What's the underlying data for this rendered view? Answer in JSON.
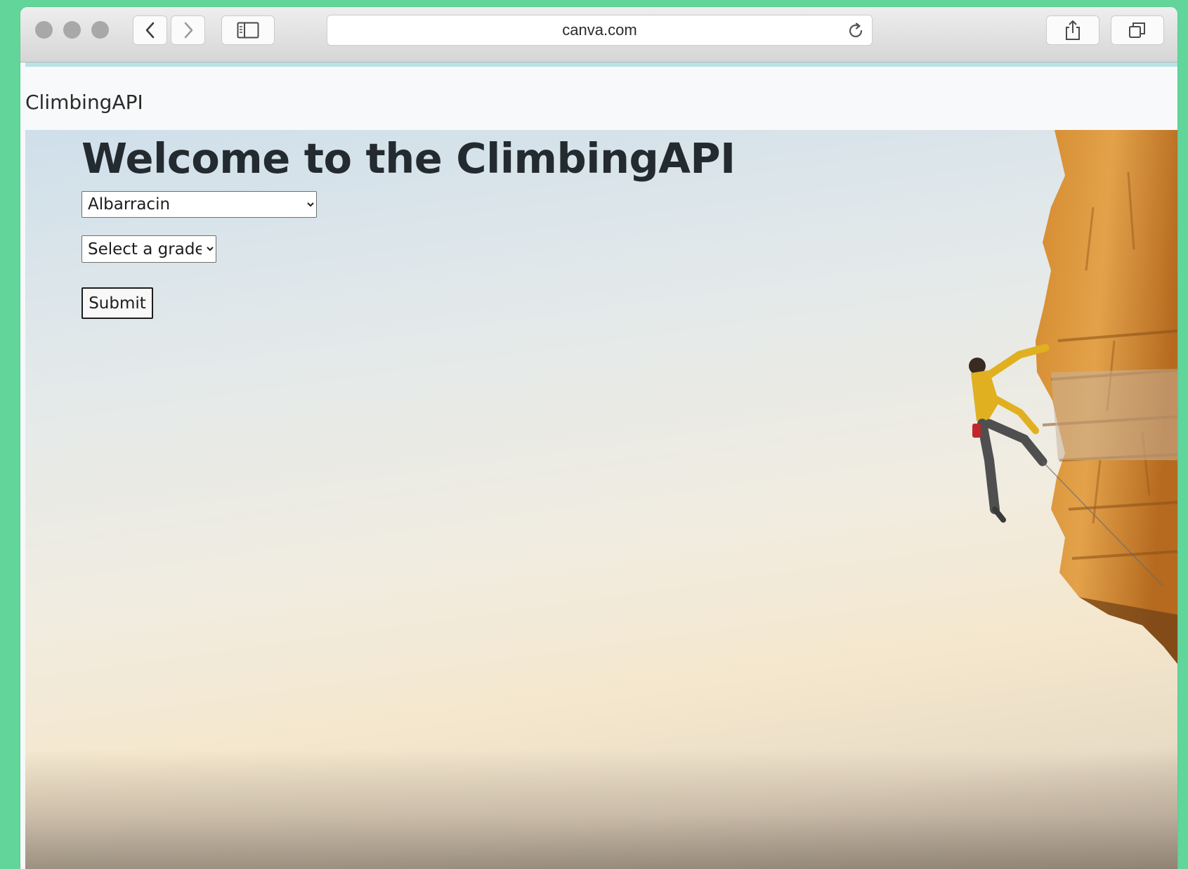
{
  "browser": {
    "url": "canva.com",
    "icons": [
      "chevron-left-icon",
      "chevron-right-icon",
      "sidebar-icon",
      "reload-icon",
      "share-icon",
      "tabs-icon"
    ]
  },
  "navbar": {
    "brand": "ClimbingAPI"
  },
  "hero": {
    "title": "Welcome to the ClimbingAPI",
    "crag_select": {
      "selected": "Albarracin"
    },
    "grade_select": {
      "selected": "Select a grade"
    },
    "submit_label": "Submit"
  },
  "colors": {
    "frame_green": "#62d69a",
    "navbar_bg": "#f8f9fa",
    "progress_bar": "#b7e3e7",
    "title_text": "#232b30"
  }
}
